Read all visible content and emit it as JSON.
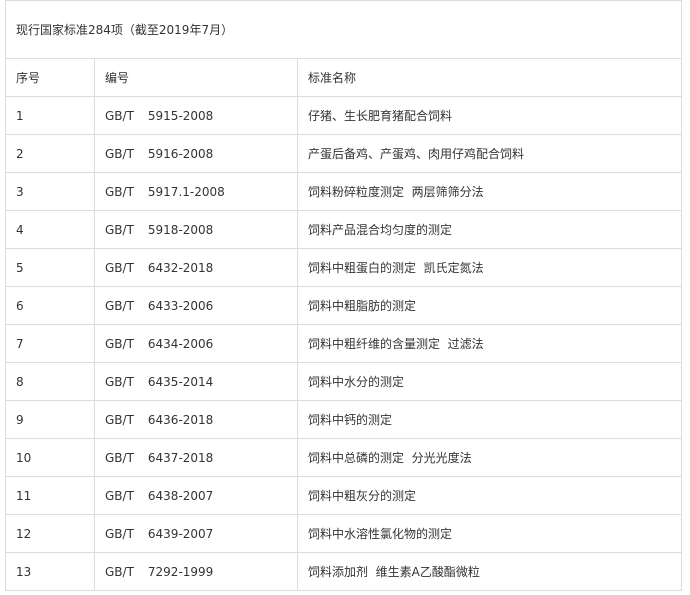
{
  "table": {
    "title": "现行国家标准284项（截至2019年7月）",
    "headers": {
      "seq": "序号",
      "code": "编号",
      "name": "标准名称"
    },
    "rows": [
      {
        "seq": "1",
        "prefix": "GB/T",
        "number": "5915-2008",
        "name": "仔猪、生长肥育猪配合饲料"
      },
      {
        "seq": "2",
        "prefix": "GB/T",
        "number": "5916-2008",
        "name": "产蛋后备鸡、产蛋鸡、肉用仔鸡配合饲料"
      },
      {
        "seq": "3",
        "prefix": "GB/T",
        "number": "5917.1-2008",
        "name": "饲料粉碎粒度测定  两层筛筛分法"
      },
      {
        "seq": "4",
        "prefix": "GB/T",
        "number": "5918-2008",
        "name": "饲料产品混合均匀度的测定"
      },
      {
        "seq": "5",
        "prefix": "GB/T",
        "number": "6432-2018",
        "name": "饲料中粗蛋白的测定  凯氏定氮法"
      },
      {
        "seq": "6",
        "prefix": "GB/T",
        "number": "6433-2006",
        "name": "饲料中粗脂肪的测定"
      },
      {
        "seq": "7",
        "prefix": "GB/T",
        "number": "6434-2006",
        "name": "饲料中粗纤维的含量测定  过滤法"
      },
      {
        "seq": "8",
        "prefix": "GB/T",
        "number": "6435-2014",
        "name": "饲料中水分的测定"
      },
      {
        "seq": "9",
        "prefix": "GB/T",
        "number": "6436-2018",
        "name": "饲料中钙的测定"
      },
      {
        "seq": "10",
        "prefix": "GB/T",
        "number": "6437-2018",
        "name": "饲料中总磷的测定  分光光度法"
      },
      {
        "seq": "11",
        "prefix": "GB/T",
        "number": "6438-2007",
        "name": "饲料中粗灰分的测定"
      },
      {
        "seq": "12",
        "prefix": "GB/T",
        "number": "6439-2007",
        "name": "饲料中水溶性氯化物的测定"
      },
      {
        "seq": "13",
        "prefix": "GB/T",
        "number": "7292-1999",
        "name": "饲料添加剂  维生素A乙酸酯微粒"
      }
    ]
  }
}
